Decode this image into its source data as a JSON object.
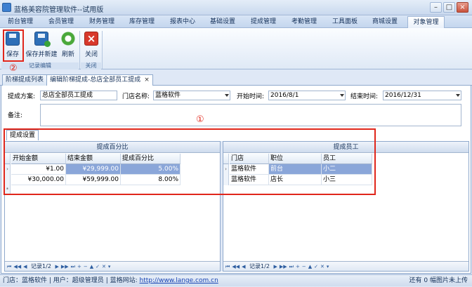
{
  "window": {
    "title": "蓝格美容院管理软件--试用版"
  },
  "menu": [
    {
      "label": "前台管理"
    },
    {
      "label": "会员管理"
    },
    {
      "label": "财务管理"
    },
    {
      "label": "库存管理"
    },
    {
      "label": "报表中心"
    },
    {
      "label": "基础设置"
    },
    {
      "label": "提成管理"
    },
    {
      "label": "考勤管理"
    },
    {
      "label": "工具面板"
    },
    {
      "label": "商城设置"
    },
    {
      "label": "对象管理"
    }
  ],
  "ribbon": {
    "save": "保存",
    "save_new": "保存并新建",
    "refresh": "刷新",
    "close": "关闭",
    "group_record_edit": "记录编辑",
    "group_close": "关闭"
  },
  "annotations": {
    "circle_1": "①",
    "circle_2": "②"
  },
  "doc_tabs": [
    {
      "label": "阶梯提成列表"
    },
    {
      "label": "编辑阶梯提成-总店全部员工提成",
      "close": "×"
    }
  ],
  "form": {
    "plan_label": "提成方案:",
    "plan_value": "总店全部员工提成",
    "store_label": "门店名称:",
    "store_value": "蓝格软件",
    "start_label": "开始时间:",
    "start_value": "2016/8/1",
    "end_label": "结束时间:",
    "end_value": "2016/12/31",
    "note_label": "备注:"
  },
  "subtab": {
    "label": "提成设置"
  },
  "left_grid": {
    "title": "提成百分比",
    "columns": [
      "开始金额",
      "结束金额",
      "提成百分比"
    ],
    "rows": [
      [
        "¥1.00",
        "¥29,999.00",
        "5.00%"
      ],
      [
        "¥30,000.00",
        "¥59,999.00",
        "8.00%"
      ]
    ],
    "nav": "记录1/2"
  },
  "right_grid": {
    "title": "提成员工",
    "columns": [
      "门店",
      "职位",
      "员工"
    ],
    "rows": [
      [
        "蓝格软件",
        "前台",
        "小二"
      ],
      [
        "蓝格软件",
        "店长",
        "小三"
      ]
    ],
    "nav": "记录1/2"
  },
  "status": {
    "store": "门店：蓝格软件",
    "user": "用户：超级管理员",
    "site_label": "蓝格网站:",
    "site_url": "http://www.lange.com.cn",
    "right": "还有 0 幅图片未上传"
  }
}
